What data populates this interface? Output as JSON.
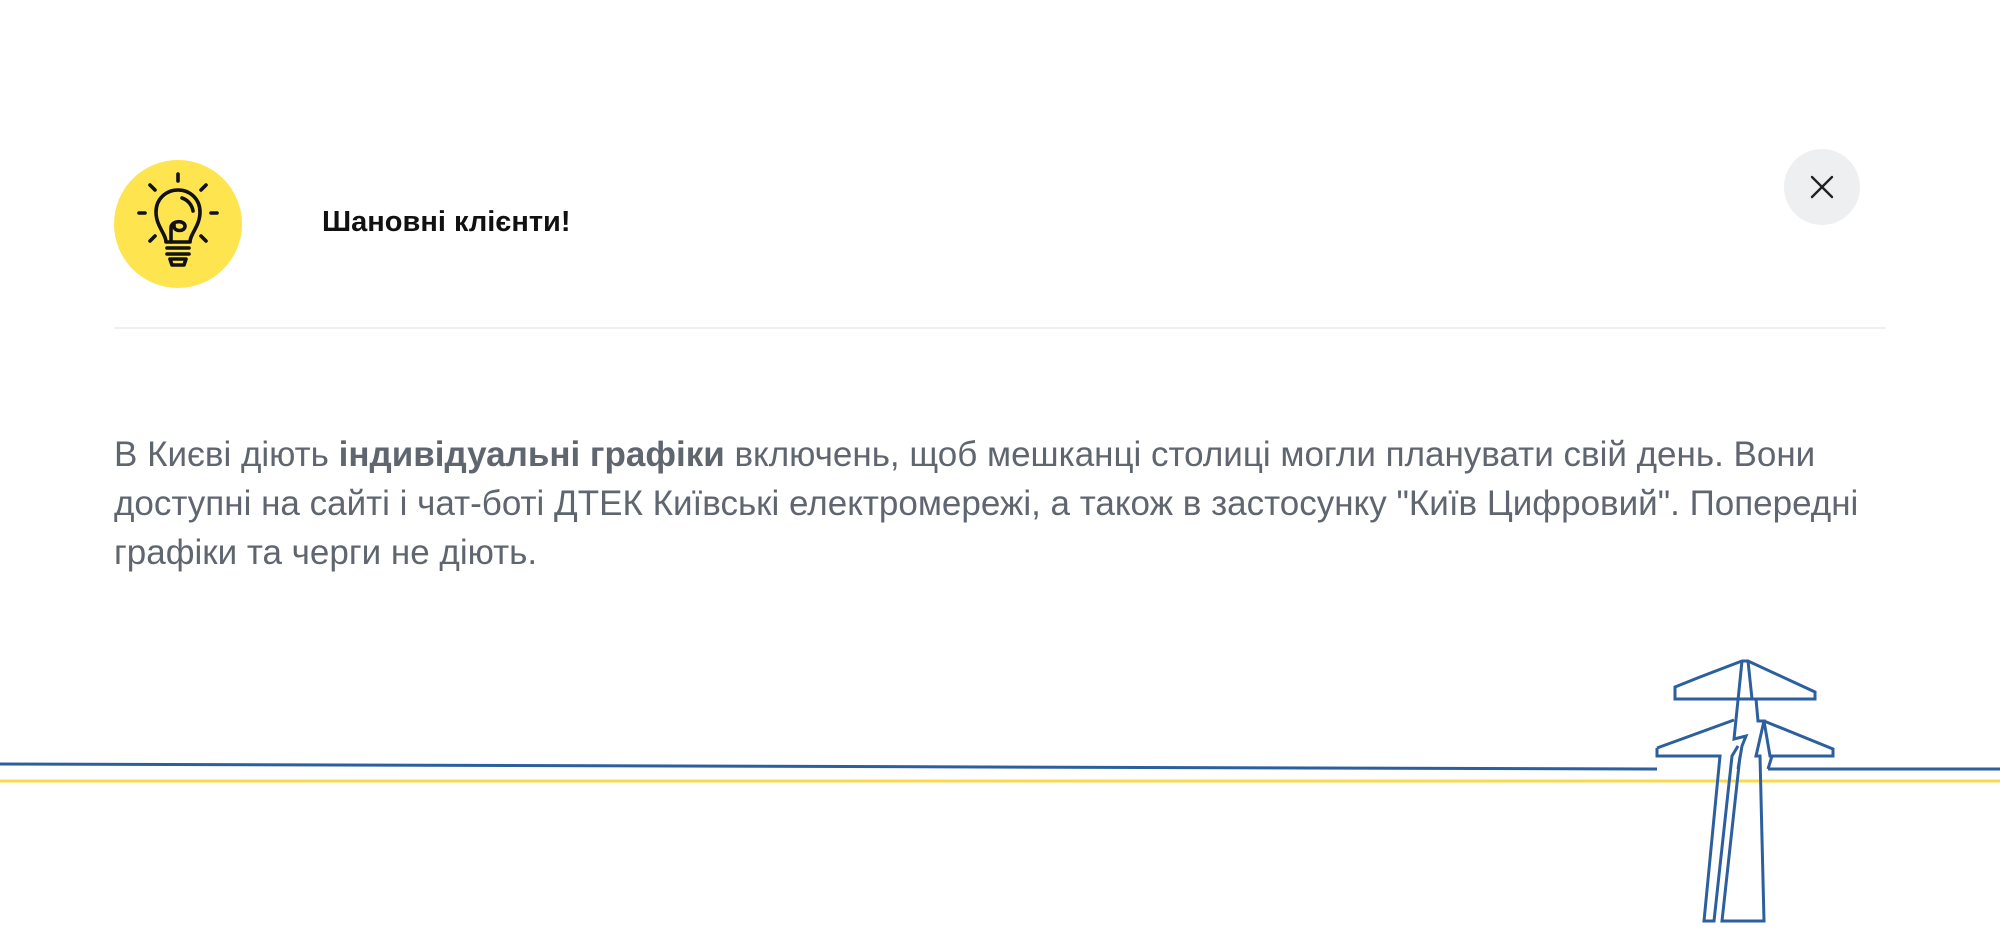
{
  "modal": {
    "title": "Шановні клієнти!",
    "close_label": "×",
    "message": {
      "intro": "В Києві діють ",
      "highlight": "індивідуальні графіки",
      "rest": " включень, щоб мешканці столиці могли планувати свій день. Вони доступні на сайті і чат-боті ДТЕК Київські електромережі, а також в застосунку \"Київ Цифровий\". Попередні графіки та черги не діють."
    }
  },
  "icons": {
    "header_icon": "lightbulb-icon",
    "close_icon": "close-icon",
    "decoration": "power-pylon-illustration"
  },
  "colors": {
    "accent_yellow": "#fee44f",
    "line_blue": "#2c5f9e",
    "line_yellow": "#fcd94a",
    "text_gray": "#5f6670",
    "title_black": "#111111"
  }
}
